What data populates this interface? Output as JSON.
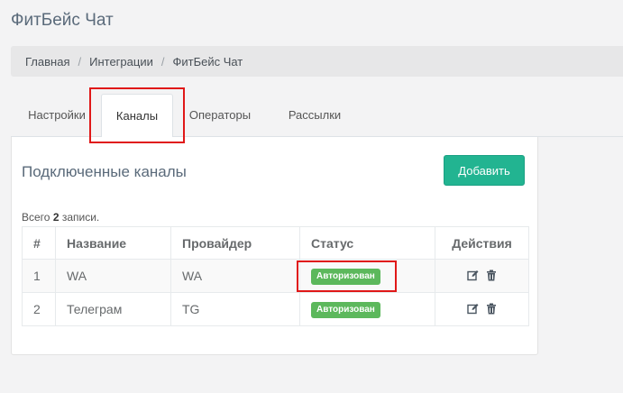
{
  "page": {
    "title": "ФитБейс Чат"
  },
  "breadcrumb": {
    "home": "Главная",
    "integrations": "Интеграции",
    "current": "ФитБейс Чат",
    "separator": "/"
  },
  "tabs": [
    {
      "label": "Настройки"
    },
    {
      "label": "Каналы",
      "active": true
    },
    {
      "label": "Операторы"
    },
    {
      "label": "Рассылки"
    }
  ],
  "panel": {
    "title": "Подключенные каналы",
    "add_button": "Добавить",
    "total_prefix": "Всего",
    "total_count": "2",
    "total_suffix": "записи."
  },
  "table": {
    "headers": {
      "num": "#",
      "name": "Название",
      "provider": "Провайдер",
      "status": "Статус",
      "actions": "Действия"
    },
    "rows": [
      {
        "num": "1",
        "name": "WA",
        "provider": "WA",
        "status": "Авторизован"
      },
      {
        "num": "2",
        "name": "Телеграм",
        "provider": "TG",
        "status": "Авторизован"
      }
    ]
  },
  "icons": {
    "edit": "edit-icon",
    "delete": "trash-icon"
  },
  "colors": {
    "accent": "#22b491",
    "status_ok": "#5cb85c",
    "highlight": "#e01818"
  }
}
